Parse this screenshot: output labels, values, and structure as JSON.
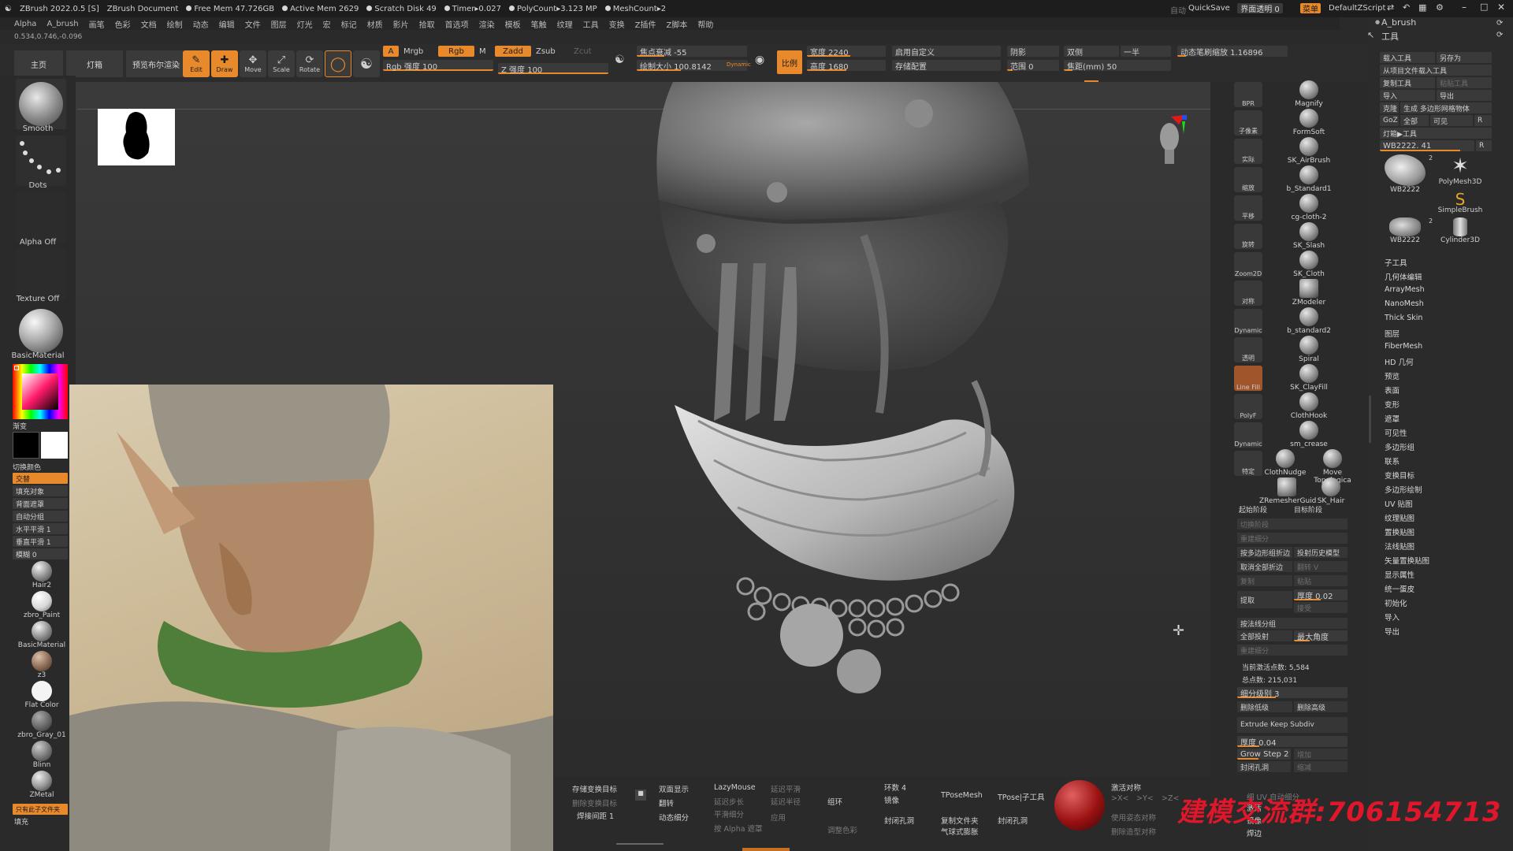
{
  "titlebar": {
    "app": "ZBrush 2022.0.5 [S]",
    "document": "ZBrush Document",
    "free_mem": "Free Mem 47.726GB",
    "active_mem": "Active Mem 2629",
    "scratch": "Scratch Disk 49",
    "timer": "Timer▸0.027",
    "polycount": "PolyCount▸3.123 MP",
    "meshcount": "MeshCount▸2",
    "autosave": "自动",
    "quicksave": "QuickSave",
    "transparency": "界面透明 0",
    "menu": "菜单",
    "script": "DefaultZScript"
  },
  "menubar": [
    "Alpha",
    "A_brush",
    "画笔",
    "色彩",
    "文档",
    "绘制",
    "动态",
    "编辑",
    "文件",
    "图层",
    "灯光",
    "宏",
    "标记",
    "材质",
    "影片",
    "拾取",
    "首选项",
    "渲染",
    "模板",
    "笔触",
    "纹理",
    "工具",
    "变换",
    "Z插件",
    "Z脚本",
    "帮助"
  ],
  "coords": "0.534,0.746,-0.096",
  "toolbar": {
    "home": "主页",
    "lightbox": "灯箱",
    "bpr": "预览布尔渲染",
    "edit": "Edit",
    "draw": "Draw",
    "move": "Move",
    "scale": "Scale",
    "rotate": "Rotate",
    "a_label": "A",
    "mrgb": "Mrgb",
    "rgb": "Rgb",
    "m": "M",
    "zadd": "Zadd",
    "zsub": "Zsub",
    "zcut": "Zcut",
    "rgb_intensity": "Rgb 强度 100",
    "z_intensity": "Z 强度 100",
    "focal_shift": "焦点衰减 -55",
    "draw_size": "绘制大小 100.8142",
    "dynamic": "Dynamic",
    "ratio": "比例",
    "width": "宽度 2240",
    "height": "高度 1680",
    "custom": "启用自定义",
    "storage": "存储配置",
    "shadow": "阴影",
    "range": "范围 0",
    "double": "双侧",
    "half": "一半",
    "focal_mm": "焦距(mm) 50",
    "dyn_zoom": "动态笔刷缩放 1.16896"
  },
  "left_shelf": {
    "brush": "Smooth",
    "stroke": "Dots",
    "alpha": "Alpha Off",
    "texture": "Texture Off",
    "material": "BasicMaterial",
    "gradient": "渐变",
    "switch_color": "切换颜色",
    "alternate": "交替",
    "fill_object": "填充对象",
    "backface": "背面遮罩",
    "auto_group": "自动分组",
    "h_smooth": "水平平滑 1",
    "v_smooth": "垂直平滑 1",
    "blur": "模糊 0",
    "materials": [
      "Hair2",
      "zbro_Paint",
      "BasicMaterial",
      "z3",
      "Flat Color",
      "zbro_Gray_01",
      "Blinn",
      "ZMetal"
    ],
    "subtool_btn": "只有此子文件夹",
    "fill": "填充"
  },
  "vstrip": [
    "BPR",
    "子像素",
    "实际",
    "缩放",
    "平移",
    "旋转",
    "Zoom2D",
    "对称",
    "Dynamic",
    "透明",
    "Line Fill",
    "PolyF",
    "Dynamic",
    "特定"
  ],
  "brushes": [
    "Magnify",
    "FormSoft",
    "SK_AirBrush",
    "b_Standard1",
    "cg-cloth-2",
    "SK_Slash",
    "SK_Cloth",
    "ZModeler",
    "b_standard2",
    "Spiral",
    "SK_ClayFill",
    "ClothHook",
    "sm_crease",
    "ClothNudge",
    "Move Topologica",
    "ZRemesherGuid",
    "SK_Hair"
  ],
  "toolpanel": {
    "header": "A_brush",
    "tool": "工具",
    "load": "载入工具",
    "save_as": "另存为",
    "load_project": "从项目文件载入工具",
    "copy": "复制工具",
    "paste": "粘贴工具",
    "import": "导入",
    "export": "导出",
    "clone": "克隆",
    "polymesh": "生成 多边形网格物体",
    "goz": "GoZ",
    "all": "全部",
    "visible": "可见",
    "r": "R",
    "lightbox_tool": "灯箱▶工具",
    "current": "WB2222. 41",
    "tools": [
      "WB2222",
      "PolyMesh3D",
      "SimpleBrush",
      "WB2222",
      "Cylinder3D"
    ],
    "count_a": "2",
    "count_b": "2",
    "menu": [
      "子工具",
      "几何体编辑",
      "ArrayMesh",
      "NanoMesh",
      "Thick Skin",
      "图层",
      "FiberMesh",
      "HD 几何",
      "预览",
      "表面",
      "变形",
      "遮罩",
      "可见性",
      "多边形组",
      "联系",
      "变换目标",
      "多边形绘制",
      "UV 贴图",
      "纹理贴图",
      "置换贴图",
      "法线贴图",
      "矢量置换贴图",
      "显示属性",
      "统一蛋皮",
      "初始化",
      "导入",
      "导出"
    ]
  },
  "subtool_settings": {
    "start_level": "起始阶段",
    "target_level": "目标阶段",
    "cut_level": "切换阶段",
    "resub": "重建细分",
    "crease_pg": "按多边形组折边",
    "project_history": "投射历史模型",
    "uncrease_all": "取消全部折边",
    "flip_v": "翻转 V",
    "copy": "复制",
    "paste": "粘贴",
    "extract": "提取",
    "thick": "厚度 0.02",
    "accept": "接受",
    "by_normal": "按法线分组",
    "project_all": "全部投射",
    "max_angle": "最大角度",
    "rebuild": "重建细分",
    "active_points": "当前激活点数: 5,584",
    "total_points": "总点数: 215,031",
    "subdiv_level": "细分级别 3",
    "del_lower": "删除低级",
    "del_higher": "删除高级",
    "extrude": "Extrude Keep Subdiv",
    "thickness": "厚度 0.04",
    "grow_step": "Grow Step 2",
    "add": "增加",
    "close_holes": "封闭孔洞",
    "reduce": "缩减",
    "uv_subdiv": "细 UV 自动细分",
    "active": "激活",
    "mirror": "镜像",
    "weld": "焊边"
  },
  "bottombar": {
    "store_morph": "存储变换目标",
    "del_morph": "删除变换目标",
    "weld_dist": "焊接间距 1",
    "double": "双面显示",
    "flip": "翻转",
    "dyn_subdiv": "动态细分",
    "lazymouse": "LazyMouse",
    "lazy_step": "延迟步长",
    "smooth_sub": "平滑细分",
    "alpha_mask": "按 Alpha 遮罩",
    "lazy_smooth": "延迟平滑",
    "lazy_radius": "延迟半径",
    "apply": "应用",
    "group": "组环",
    "loops": "环数 4",
    "mirror_weld": "镜像",
    "close_holes": "封闭孔洞",
    "adjust_color": "调整色彩",
    "tpose": "TPoseMesh",
    "tpose_sub": "TPose|子工具",
    "copy_folder": "复制文件夹",
    "sphere": "气球式膨胀",
    "close_holes2": "封闭孔洞",
    "activate_sym": "激活对称",
    "use_pose_sym": "使用姿态对称",
    "del_model_sym": "删除造型对称",
    "sym_x": ">X<",
    "sym_y": ">Y<",
    "sym_z": ">Z<"
  },
  "watermark": "建模交流群:706154713",
  "colors": {
    "accent": "#e8892c",
    "panel": "#2b2b2b",
    "button": "#3a3a3a",
    "watermark": "#e0162b"
  }
}
